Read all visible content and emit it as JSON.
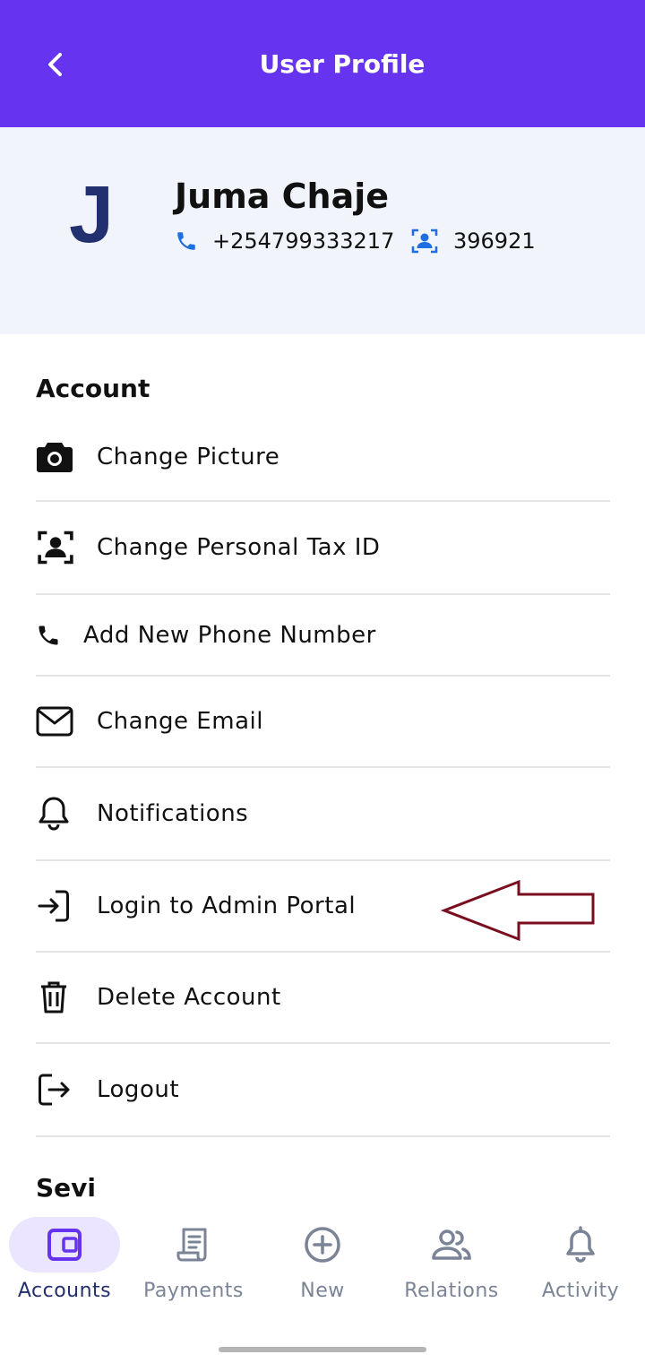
{
  "header": {
    "title": "User Profile",
    "back_icon": "chevron-left-icon"
  },
  "profile": {
    "initial": "J",
    "name": "Juma Chaje",
    "phone": "+254799333217",
    "tax_id": "396921",
    "phone_icon": "phone-icon",
    "tax_icon": "id-badge-icon"
  },
  "sections": {
    "account": "Account",
    "services": "Sevi"
  },
  "account_items": [
    {
      "label": "Change Picture",
      "icon": "camera-icon"
    },
    {
      "label": "Change Personal Tax ID",
      "icon": "id-badge-icon"
    },
    {
      "label": "Add New Phone Number",
      "icon": "phone-icon"
    },
    {
      "label": "Change Email",
      "icon": "mail-icon"
    },
    {
      "label": "Notifications",
      "icon": "bell-icon"
    },
    {
      "label": "Login to Admin Portal",
      "icon": "login-icon"
    },
    {
      "label": "Delete Account",
      "icon": "trash-icon"
    },
    {
      "label": "Logout",
      "icon": "logout-icon"
    }
  ],
  "bottom_nav": {
    "active": "Accounts",
    "items": [
      {
        "label": "Accounts",
        "icon": "wallet-icon"
      },
      {
        "label": "Payments",
        "icon": "receipt-icon"
      },
      {
        "label": "New",
        "icon": "plus-circle-icon"
      },
      {
        "label": "Relations",
        "icon": "users-icon"
      },
      {
        "label": "Activity",
        "icon": "bell-icon"
      }
    ]
  },
  "colors": {
    "header_bg": "#6633ee",
    "profile_bg": "#f1f4fb",
    "avatar_text": "#23306f",
    "accent_blue": "#1f6fe0",
    "nav_active_pill": "#ebe5ff",
    "nav_active_icon": "#6633ee",
    "nav_inactive": "#7b8497",
    "annotation_arrow": "#7a0d1e"
  }
}
